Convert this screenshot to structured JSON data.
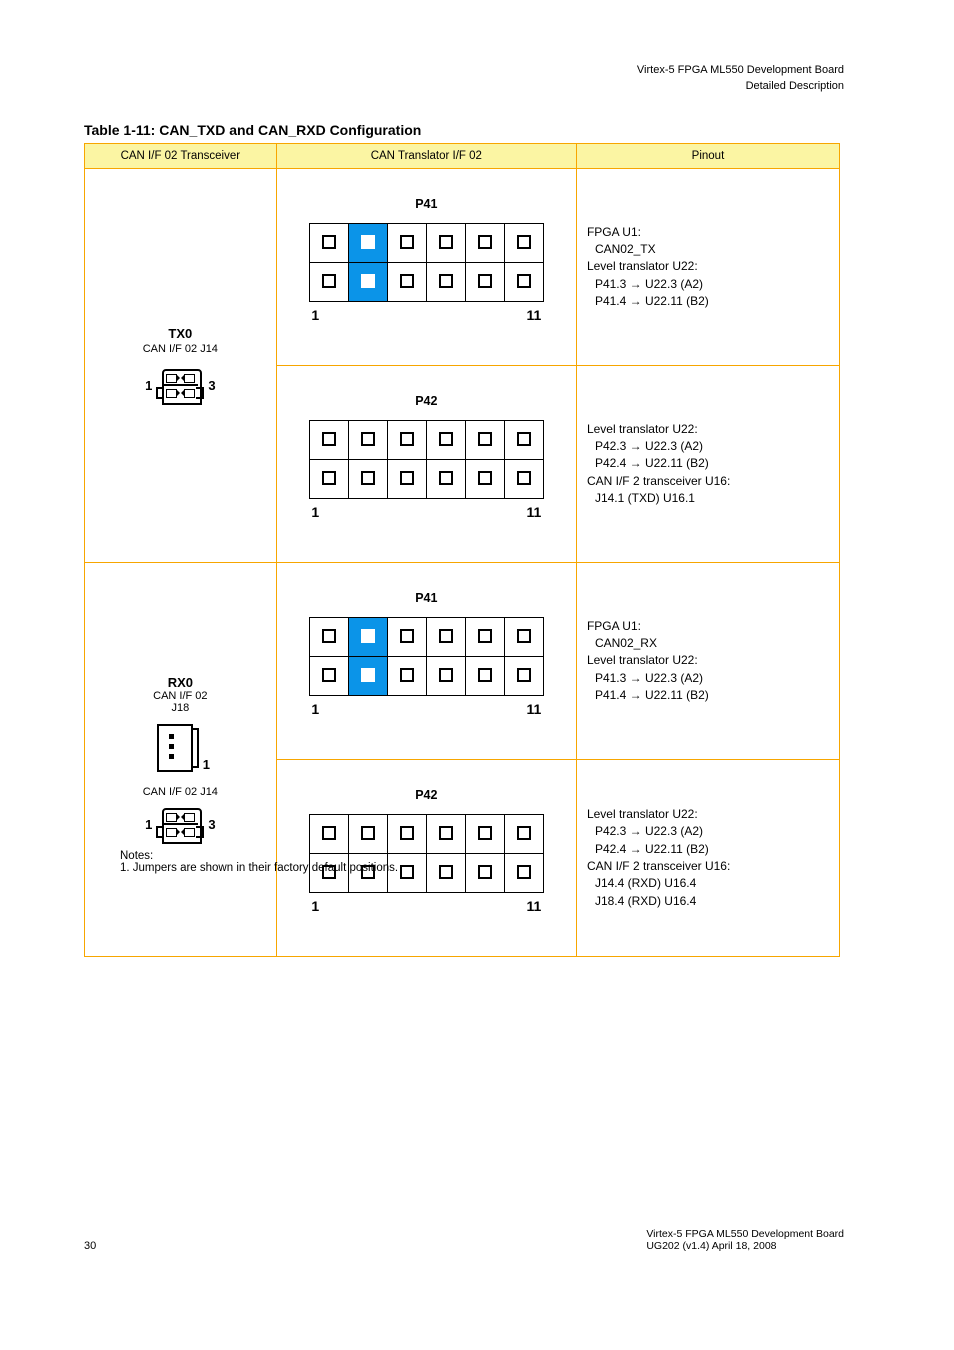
{
  "top_right_line1": "Virtex-5 FPGA ML550 Development Board",
  "top_right_line2": "Detailed Description",
  "section_title": "Table 1-11: CAN_TXD and CAN_RXD Configuration",
  "headers": {
    "a": "CAN I/F 02 Transceiver",
    "b": "CAN Translator I/F 02",
    "c": "Pinout"
  },
  "rows": [
    {
      "left_title": "TX0",
      "left_sub": "CAN I/F 02 J14",
      "left_icon": {
        "type": "conn4",
        "lbl_left": "1",
        "lbl_right": "3"
      },
      "right_blocks": [
        {
          "title": "P41",
          "lbl_left": "1",
          "lbl_right": "11",
          "highlight": [
            2,
            8
          ],
          "pinout": [
            "FPGA U1:",
            "  CAN02_TX",
            "Level translator U22:",
            "  P41.3 → U22.3 (A2)",
            "  P41.4 → U22.11 (B2)"
          ]
        },
        {
          "title": "P42",
          "lbl_left": "1",
          "lbl_right": "11",
          "highlight": [],
          "pinout": [
            "Level translator U22:",
            "  P42.3 → U22.3 (A2)",
            "  P42.4 → U22.11 (B2)",
            "CAN I/F 2 transceiver U16:",
            "  J14.1 (TXD) U16.1"
          ]
        }
      ]
    },
    {
      "left_title": "RX0",
      "left_sub": "CAN I/F 02",
      "left_sub2": "J18",
      "left_sub3": "CAN I/F 02 J14",
      "left_icons": [
        {
          "type": "usb",
          "lbl": "1"
        },
        {
          "type": "conn4",
          "lbl_left": "1",
          "lbl_right": "3"
        }
      ],
      "right_blocks": [
        {
          "title": "P41",
          "lbl_left": "1",
          "lbl_right": "11",
          "highlight": [
            2,
            8
          ],
          "pinout": [
            "FPGA U1:",
            "  CAN02_RX",
            "Level translator U22:",
            "  P41.3 → U22.3 (A2)",
            "  P41.4 → U22.11 (B2)"
          ]
        },
        {
          "title": "P42",
          "lbl_left": "1",
          "lbl_right": "11",
          "highlight": [],
          "pinout": [
            "Level translator U22:",
            "  P42.3 → U22.3 (A2)",
            "  P42.4 → U22.11 (B2)",
            "CAN I/F 2 transceiver U16:",
            "  J14.4 (RXD) U16.4",
            "  J18.4 (RXD) U16.4"
          ]
        }
      ]
    }
  ],
  "footnote": "Notes:\n1. Jumpers are shown in their factory default positions.",
  "foot_left": "30",
  "foot_right": "Virtex-5 FPGA ML550 Development Board\nUG202 (v1.4) April 18, 2008"
}
